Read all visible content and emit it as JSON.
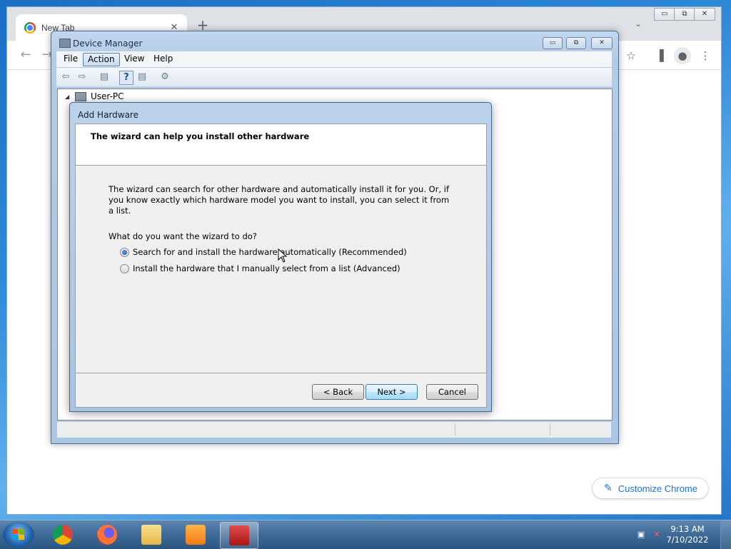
{
  "chrome": {
    "tab_title": "New Tab",
    "tab_close": "✕",
    "new_tab": "+",
    "tab_search": "⌄",
    "win_min": "▭",
    "win_max": "⧉",
    "win_close": "✕",
    "back": "←",
    "forward": "→",
    "star": "☆",
    "sidepanel": "▐",
    "profile": "●",
    "menu": "⋮",
    "customize_icon": "✎",
    "customize_label": "Customize Chrome"
  },
  "device_manager": {
    "title": "Device Manager",
    "minimize": "▭",
    "restore": "⧉",
    "close": "✕",
    "menus": [
      "File",
      "Action",
      "View",
      "Help"
    ],
    "active_menu": "Action",
    "toolbar": {
      "back": "⇦",
      "forward": "⇨",
      "show_hide": "▤",
      "help": "?",
      "properties": "▤",
      "scan": "⚙"
    },
    "tree_root": "User-PC",
    "tree_expand": "◢"
  },
  "wizard": {
    "title": "Add Hardware",
    "header": "The wizard can help you install other hardware",
    "description": "The wizard can search for other hardware and automatically install it for you. Or, if you know exactly which hardware model you want to install, you can select it from a list.",
    "question": "What do you want the wizard to do?",
    "options": [
      {
        "label": "Search for and install the hardware automatically (Recommended)",
        "selected": true
      },
      {
        "label": "Install the hardware that I manually select from a list (Advanced)",
        "selected": false
      }
    ],
    "buttons": {
      "back": "< Back",
      "next": "Next >",
      "cancel": "Cancel"
    }
  },
  "taskbar": {
    "apps": [
      "chrome-icon",
      "firefox-icon",
      "file-explorer-icon",
      "media-player-icon",
      "device-manager-icon"
    ],
    "active_app": "device-manager-icon",
    "time": "9:13 AM",
    "date": "7/10/2022",
    "network_icon": "▣",
    "volume_icon": "✕"
  },
  "colors": {
    "accent": "#1a73e8",
    "desktop": "#2f8ad8",
    "window_frame": "#b2cbe6"
  }
}
